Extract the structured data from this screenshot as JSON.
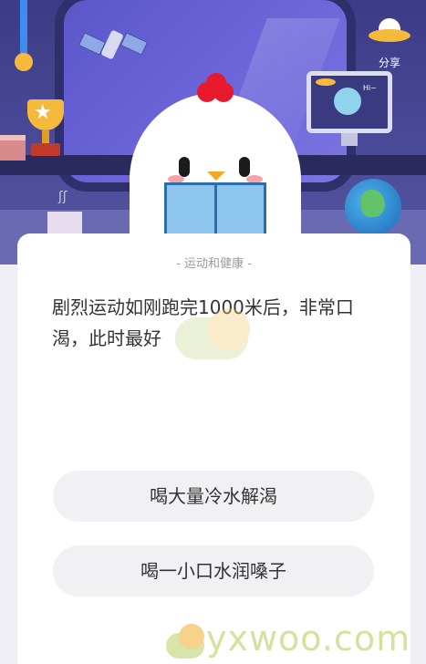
{
  "header": {
    "share_label": "分享",
    "monitor_text": "Hi~"
  },
  "quiz": {
    "category": "- 运动和健康 -",
    "question": "剧烈运动如刚跑完1000米后，非常口渴，此时最好",
    "options": [
      "喝大量冷水解渴",
      "喝一小口水润嗓子"
    ]
  },
  "watermark": {
    "text": "yxwoo.com"
  },
  "icons": {
    "share": "ufo-share-icon",
    "mascot": "chick-mascot"
  },
  "colors": {
    "header_bg": "#4a4a98",
    "card_bg": "#ffffff",
    "option_bg": "#f1f1f3",
    "comb": "#e8182d"
  }
}
